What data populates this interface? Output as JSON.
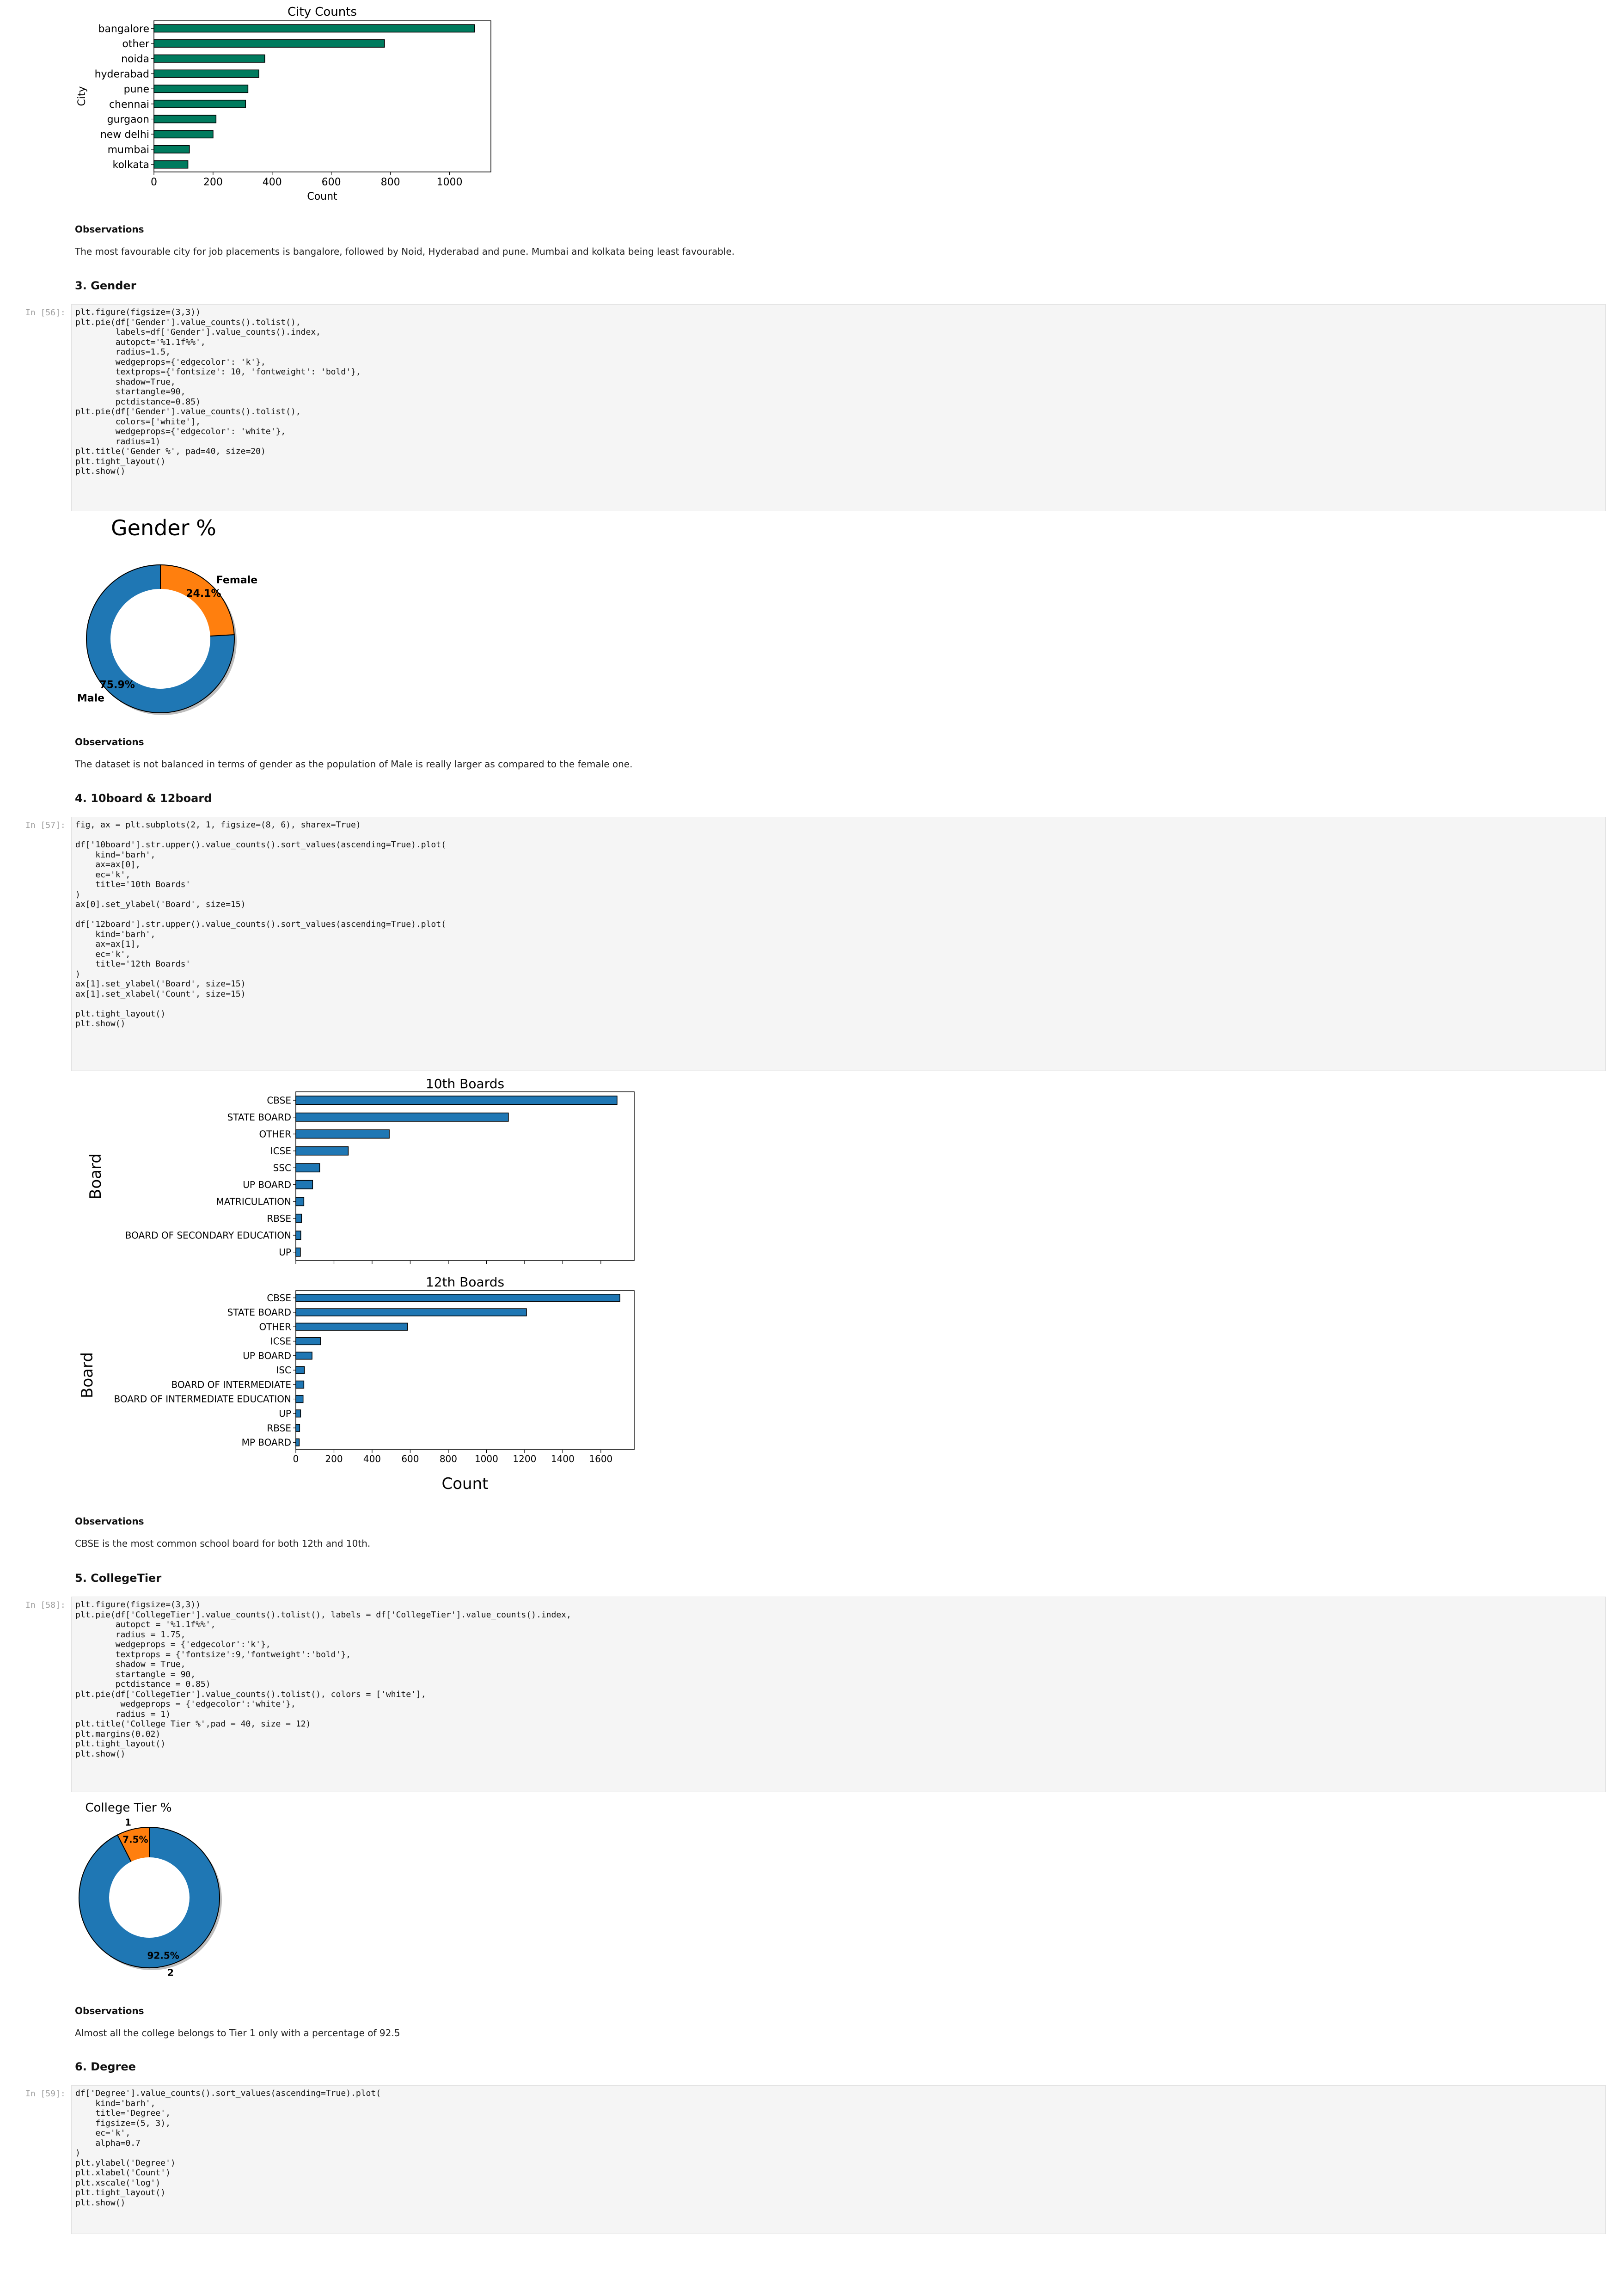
{
  "colors": {
    "city_bar": "#007b5e",
    "board_bar": "#1f77b4",
    "pie_blue": "#1f77b4",
    "pie_orange": "#ff7f0e",
    "code_bg": "#f5f5f5",
    "prompt": "#9e9e9e"
  },
  "sections": {
    "city_obs_title": "Observations",
    "city_obs_text": "The most favourable city for job placements is bangalore, followed by Noid, Hyderabad and pune. Mumbai and kolkata being least favourable.",
    "gender_heading": "3. Gender",
    "gender_obs_title": "Observations",
    "gender_obs_text": "The dataset is not balanced in terms of gender as the population of Male is really larger as compared to the female one.",
    "board_heading": "4. 10board & 12board",
    "board_obs_title": "Observations",
    "board_obs_text": "CBSE is the most common school board for both 12th and 10th.",
    "tier_heading": "5. CollegeTier",
    "tier_obs_title": "Observations",
    "tier_obs_text": "Almost all the college belongs to Tier 1 only with a percentage of 92.5",
    "degree_heading": "6. Degree"
  },
  "cells": [
    {
      "prompt": "In [56]:",
      "lines": [
        "plt.figure(figsize=(3,3))",
        "plt.pie(df['Gender'].value_counts().tolist(),",
        "        labels=df['Gender'].value_counts().index,",
        "        autopct='%1.1f%%',",
        "        radius=1.5,",
        "        wedgeprops={'edgecolor': 'k'},",
        "        textprops={'fontsize': 10, 'fontweight': 'bold'},",
        "        shadow=True,",
        "        startangle=90,",
        "        pctdistance=0.85)",
        "plt.pie(df['Gender'].value_counts().tolist(),",
        "        colors=['white'],",
        "        wedgeprops={'edgecolor': 'white'},",
        "        radius=1)",
        "plt.title('Gender %', pad=40, size=20)",
        "plt.tight_layout()",
        "plt.show()"
      ]
    },
    {
      "prompt": "In [57]:",
      "lines": [
        "fig, ax = plt.subplots(2, 1, figsize=(8, 6), sharex=True)",
        "",
        "df['10board'].str.upper().value_counts().sort_values(ascending=True).plot(",
        "    kind='barh',",
        "    ax=ax[0],",
        "    ec='k',",
        "    title='10th Boards'",
        ")",
        "ax[0].set_ylabel('Board', size=15)",
        "",
        "df['12board'].str.upper().value_counts().sort_values(ascending=True).plot(",
        "    kind='barh',",
        "    ax=ax[1],",
        "    ec='k',",
        "    title='12th Boards'",
        ")",
        "ax[1].set_ylabel('Board', size=15)",
        "ax[1].set_xlabel('Count', size=15)",
        "",
        "plt.tight_layout()",
        "plt.show()"
      ]
    },
    {
      "prompt": "In [58]:",
      "lines": [
        "plt.figure(figsize=(3,3))",
        "plt.pie(df['CollegeTier'].value_counts().tolist(), labels = df['CollegeTier'].value_counts().index,",
        "        autopct = '%1.1f%%',",
        "        radius = 1.75,",
        "        wedgeprops = {'edgecolor':'k'},",
        "        textprops = {'fontsize':9,'fontweight':'bold'},",
        "        shadow = True,",
        "        startangle = 90,",
        "        pctdistance = 0.85)",
        "plt.pie(df['CollegeTier'].value_counts().tolist(), colors = ['white'],",
        "         wedgeprops = {'edgecolor':'white'},",
        "        radius = 1)",
        "plt.title('College Tier %',pad = 40, size = 12)",
        "plt.margins(0.02)",
        "plt.tight_layout()",
        "plt.show()"
      ]
    },
    {
      "prompt": "In [59]:",
      "lines": [
        "df['Degree'].value_counts().sort_values(ascending=True).plot(",
        "    kind='barh',",
        "    title='Degree',",
        "    figsize=(5, 3),",
        "    ec='k',",
        "    alpha=0.7",
        ")",
        "plt.ylabel('Degree')",
        "plt.xlabel('Count')",
        "plt.xscale('log')",
        "plt.tight_layout()",
        "plt.show()"
      ]
    }
  ],
  "chart_data": [
    {
      "type": "bar",
      "orientation": "horizontal",
      "title": "City Counts",
      "xlabel": "Count",
      "ylabel": "City",
      "categories": [
        "bangalore",
        "other",
        "noida",
        "hyderabad",
        "pune",
        "chennai",
        "gurgaon",
        "new delhi",
        "mumbai",
        "kolkata"
      ],
      "values": [
        1085,
        780,
        375,
        355,
        318,
        310,
        210,
        200,
        120,
        115
      ],
      "xlim": [
        0,
        1140
      ],
      "xticks": [
        0,
        200,
        400,
        600,
        800,
        1000
      ]
    },
    {
      "type": "pie",
      "title": "Gender %",
      "labels": [
        "Male",
        "Female"
      ],
      "values": [
        75.9,
        24.1
      ],
      "value_labels": [
        "75.9%",
        "24.1%"
      ]
    },
    {
      "type": "bar",
      "orientation": "horizontal",
      "title": "10th Boards",
      "ylabel": "Board",
      "categories": [
        "CBSE",
        "STATE BOARD",
        "OTHER",
        "ICSE",
        "SSC",
        "UP BOARD",
        "MATRICULATION",
        "RBSE",
        "BOARD OF SECONDARY EDUCATION",
        "UP"
      ],
      "values": [
        1685,
        1115,
        490,
        275,
        125,
        88,
        42,
        30,
        26,
        24
      ],
      "xlim": [
        0,
        1775
      ]
    },
    {
      "type": "bar",
      "orientation": "horizontal",
      "title": "12th Boards",
      "xlabel": "Count",
      "ylabel": "Board",
      "categories": [
        "CBSE",
        "STATE BOARD",
        "OTHER",
        "ICSE",
        "UP BOARD",
        "ISC",
        "BOARD OF INTERMEDIATE",
        "BOARD OF INTERMEDIATE EDUCATION",
        "UP",
        "RBSE",
        "MP BOARD"
      ],
      "values": [
        1700,
        1210,
        585,
        130,
        85,
        45,
        42,
        38,
        25,
        20,
        18
      ],
      "xlim": [
        0,
        1775
      ],
      "xticks": [
        0,
        200,
        400,
        600,
        800,
        1000,
        1200,
        1400,
        1600
      ]
    },
    {
      "type": "pie",
      "title": "College Tier %",
      "labels": [
        "1",
        "2"
      ],
      "values": [
        7.5,
        92.5
      ],
      "value_labels": [
        "7.5%",
        "92.5%"
      ]
    }
  ]
}
